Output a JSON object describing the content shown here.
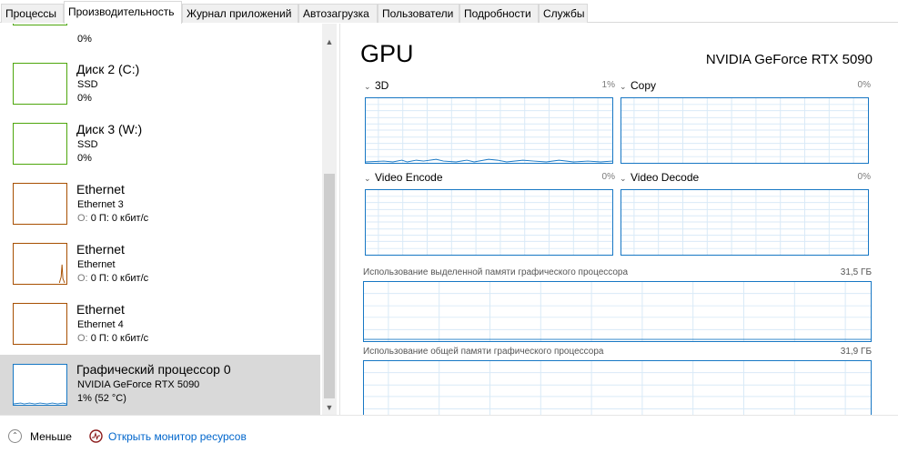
{
  "tabs": [
    {
      "label": "Процессы",
      "active": false
    },
    {
      "label": "Производительность",
      "active": true
    },
    {
      "label": "Журнал приложений",
      "active": false
    },
    {
      "label": "Автозагрузка",
      "active": false
    },
    {
      "label": "Пользователи",
      "active": false
    },
    {
      "label": "Подробности",
      "active": false
    },
    {
      "label": "Службы",
      "active": false
    }
  ],
  "sidebar": {
    "partial_item": {
      "value": "0%"
    },
    "items": [
      {
        "title": "Диск 2 (C:)",
        "sub": "SSD",
        "value": "0%",
        "color": "#4da60c"
      },
      {
        "title": "Диск 3 (W:)",
        "sub": "SSD",
        "value": "0%",
        "color": "#4da60c"
      },
      {
        "title": "Ethernet",
        "sub": "Ethernet 3",
        "value_prefix": "О:",
        "value": "0 П: 0 кбит/с",
        "color": "#a74f01"
      },
      {
        "title": "Ethernet",
        "sub": "Ethernet",
        "value_prefix": "О:",
        "value": "0 П: 0 кбит/с",
        "color": "#a74f01"
      },
      {
        "title": "Ethernet",
        "sub": "Ethernet 4",
        "value_prefix": "О:",
        "value": "0 П: 0 кбит/с",
        "color": "#a74f01"
      },
      {
        "title": "Графический процессор 0",
        "sub": "NVIDIA GeForce RTX 5090",
        "value": "1% (52 °C)",
        "color": "#1777c4",
        "selected": true
      }
    ]
  },
  "main": {
    "title": "GPU",
    "model": "NVIDIA GeForce RTX 5090",
    "engines": [
      {
        "label": "3D",
        "value": "1%"
      },
      {
        "label": "Copy",
        "value": "0%"
      },
      {
        "label": "Video Encode",
        "value": "0%"
      },
      {
        "label": "Video Decode",
        "value": "0%"
      }
    ],
    "dedicated_memory": {
      "label": "Использование выделенной памяти графического процессора",
      "value": "31,5 ГБ"
    },
    "shared_memory": {
      "label": "Использование общей памяти графического процессора",
      "value": "31,9 ГБ"
    }
  },
  "footer": {
    "less_label": "Меньше",
    "monitor_label": "Открыть монитор ресурсов"
  },
  "colors": {
    "gpu": "#1777c4",
    "disk": "#4da60c",
    "network": "#a74f01"
  }
}
